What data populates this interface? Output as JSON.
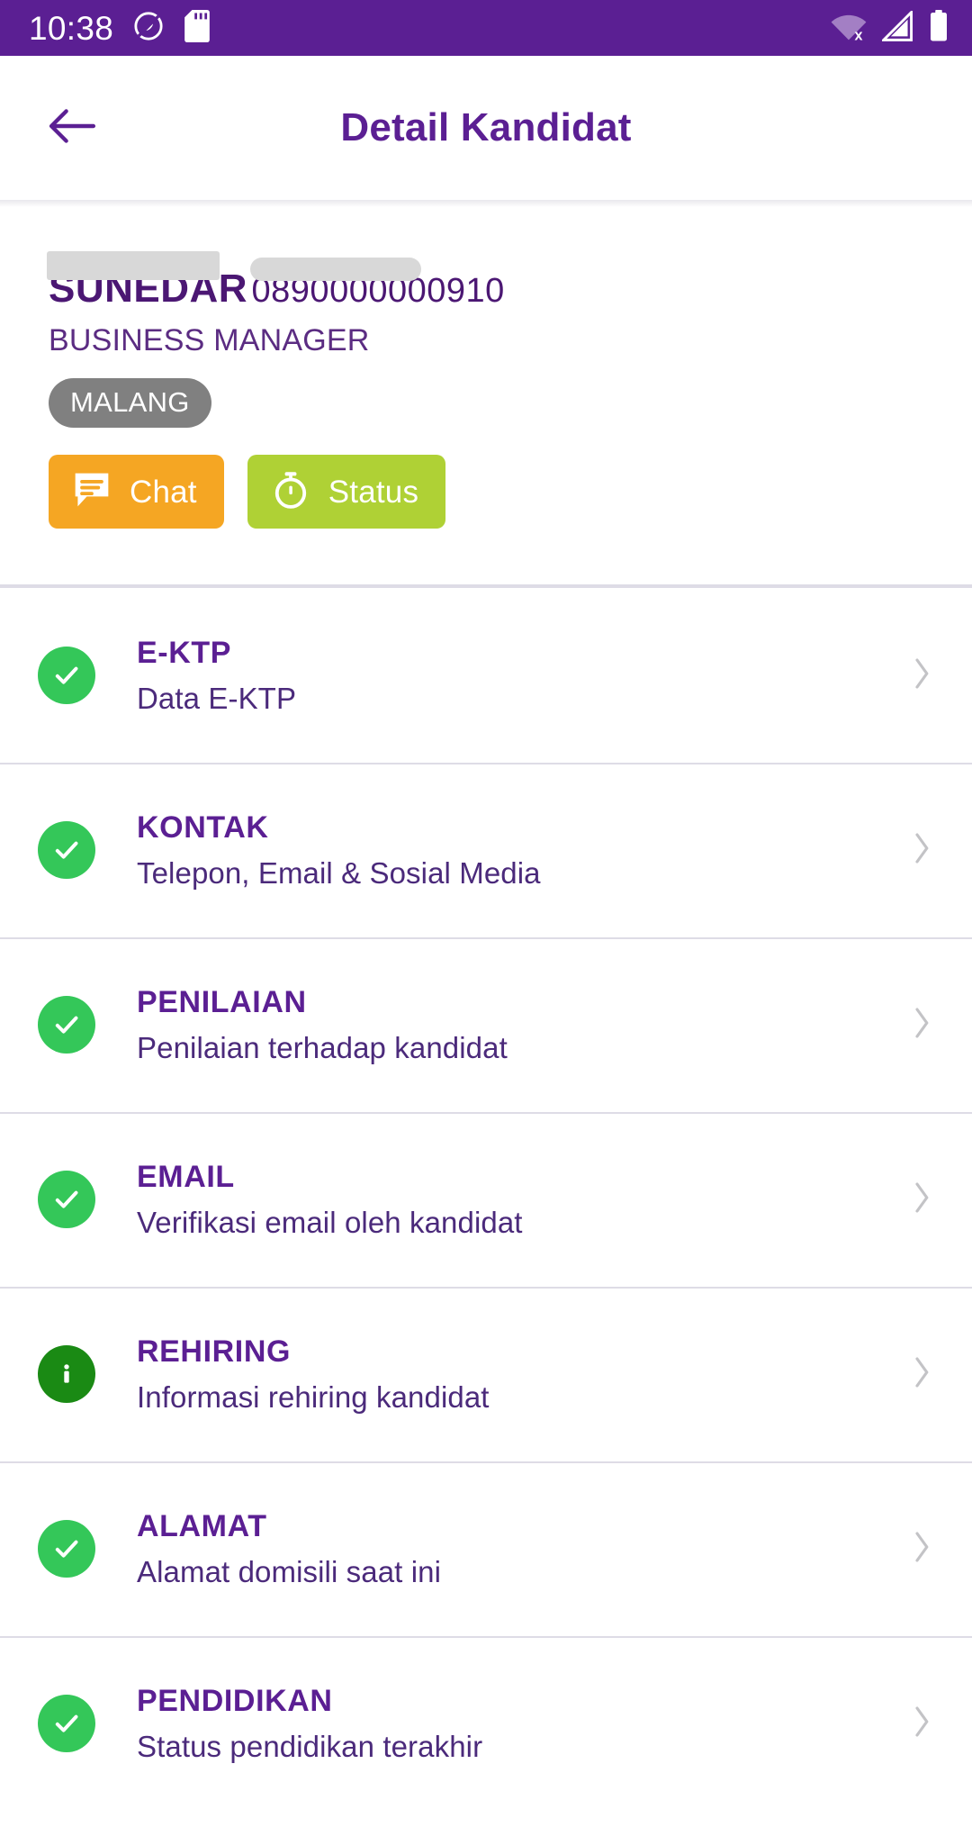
{
  "status_bar": {
    "time": "10:38",
    "icons": [
      "dnd-icon",
      "sd-card-icon",
      "wifi-off-icon",
      "cell-signal-icon",
      "battery-full-icon"
    ],
    "background": "#5B1F93"
  },
  "appbar": {
    "back_label": "back-arrow-icon",
    "title": "Detail Kandidat",
    "title_color": "#5B1F93"
  },
  "profile": {
    "name": "SUNEDAR",
    "name_redacted": true,
    "id_number": "0890000000910",
    "id_redacted": true,
    "role": "BUSINESS MANAGER",
    "city": "MALANG",
    "city_badge_color": "#808080"
  },
  "actions": [
    {
      "label": "Chat",
      "icon": "chat-bubble-icon",
      "color": "#F5A623"
    },
    {
      "label": "Status",
      "icon": "stopwatch-icon",
      "color": "#AFD135"
    }
  ],
  "list": {
    "items": [
      {
        "title": "E-KTP",
        "subtitle": "Data E-KTP",
        "icon": "check-circle-icon",
        "icon_color": "#34C759",
        "status": "complete"
      },
      {
        "title": "KONTAK",
        "subtitle": "Telepon, Email & Sosial Media",
        "icon": "check-circle-icon",
        "icon_color": "#34C759",
        "status": "complete"
      },
      {
        "title": "PENILAIAN",
        "subtitle": "Penilaian terhadap kandidat",
        "icon": "check-circle-icon",
        "icon_color": "#34C759",
        "status": "complete"
      },
      {
        "title": "EMAIL",
        "subtitle": "Verifikasi email oleh kandidat",
        "icon": "check-circle-icon",
        "icon_color": "#34C759",
        "status": "complete"
      },
      {
        "title": "REHIRING",
        "subtitle": "Informasi rehiring kandidat",
        "icon": "info-circle-icon",
        "icon_color": "#1A8A14",
        "status": "info"
      },
      {
        "title": "ALAMAT",
        "subtitle": "Alamat domisili saat ini",
        "icon": "check-circle-icon",
        "icon_color": "#34C759",
        "status": "complete"
      },
      {
        "title": "PENDIDIKAN",
        "subtitle": "Status pendidikan terakhir",
        "icon": "check-circle-icon",
        "icon_color": "#34C759",
        "status": "complete"
      }
    ]
  }
}
